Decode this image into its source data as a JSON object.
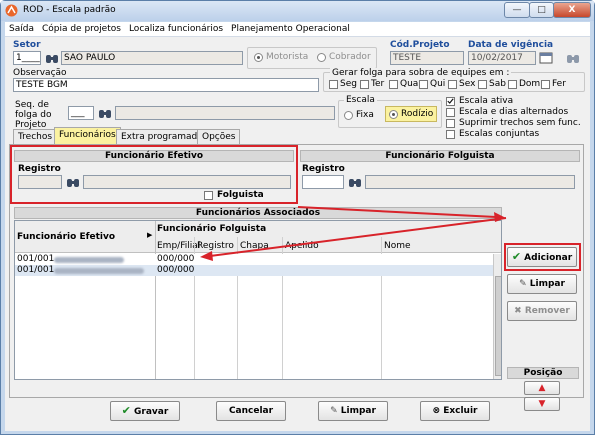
{
  "window": {
    "title": "ROD - Escala padrão",
    "min": "—",
    "max": "□",
    "close": "X"
  },
  "menu": [
    "Saída",
    "Cópia de projetos",
    "Localiza funcionários",
    "Planejamento Operacional"
  ],
  "setor": {
    "label": "Setor",
    "code": "1____",
    "name": "SAO PAULO"
  },
  "tipo": {
    "motorista": "Motorista",
    "cobrador": "Cobrador"
  },
  "cod_projeto": {
    "label": "Cód.Projeto",
    "value": "TESTE"
  },
  "data_vigencia": {
    "label": "Data de vigência",
    "value": "10/02/2017"
  },
  "observacao": {
    "label": "Observação",
    "value": "TESTE BGM"
  },
  "folga_group": {
    "label": "Gerar folga para sobra de equipes em :",
    "days": [
      "Seg",
      "Ter",
      "Qua",
      "Qui",
      "Sex",
      "Sab",
      "Dom",
      "Fer"
    ]
  },
  "seq_folga": {
    "label": "Seq. de folga do Projeto",
    "value": "___"
  },
  "escala": {
    "label": "Escala",
    "fixa": "Fixa",
    "rodizio": "Rodízio"
  },
  "options": {
    "ativa": "Escala ativa",
    "dias": "Escala e dias alternados",
    "suprimir": "Suprimir trechos sem func.",
    "conjuntas": "Escalas conjuntas"
  },
  "tabs": [
    "Trechos",
    "Funcionários",
    "Extra programado",
    "Opções"
  ],
  "efetivo": {
    "title": "Funcionário Efetivo",
    "registro": "Registro",
    "folguista": "Folguista"
  },
  "folguista": {
    "title": "Funcionário Folguista",
    "registro": "Registro"
  },
  "associados": {
    "title": "Funcionários Associados",
    "col_efetivo": "Funcionário Efetivo",
    "col_folguista": "Funcionário Folguista",
    "sub_cols": [
      "Emp/Filial",
      "Registro",
      "Chapa",
      "Apelido",
      "Nome"
    ],
    "rows": [
      {
        "efetivo": "001/001",
        "emp": "000/000"
      },
      {
        "efetivo": "001/001",
        "emp": "000/000"
      }
    ]
  },
  "side_buttons": {
    "adicionar": "Adicionar",
    "limpar": "Limpar",
    "remover": "Remover",
    "posicao": "Posição"
  },
  "footer": {
    "gravar": "Gravar",
    "cancelar": "Cancelar",
    "limpar": "Limpar",
    "excluir": "Excluir"
  },
  "colors": {
    "accent_red": "#d8232a",
    "label_blue": "#1f4e9c",
    "tab_active": "#fbf2a0"
  }
}
